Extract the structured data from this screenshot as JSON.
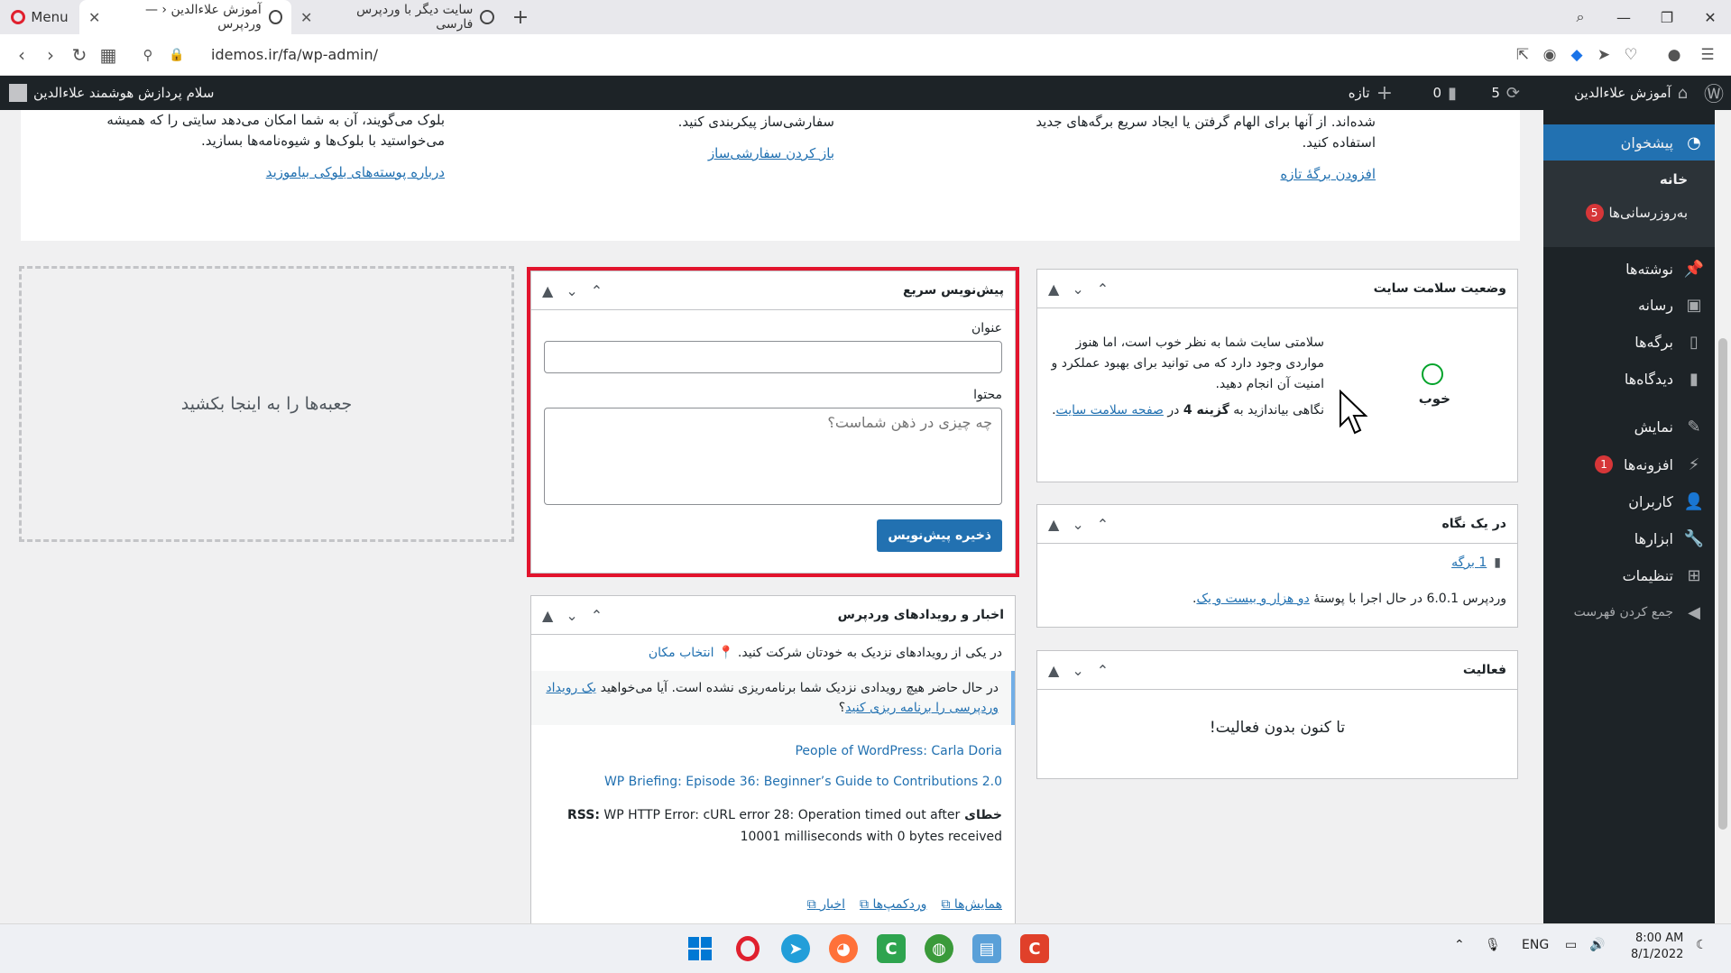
{
  "browser": {
    "menu_label": "Menu",
    "tabs": [
      {
        "title": "آموزش علاءالدین ‹ — وردپرس"
      },
      {
        "title": "سایت دیگر با وردپرس فارسی"
      }
    ],
    "url": "idemos.ir/fa/wp-admin/"
  },
  "adminbar": {
    "site_name": "آموزش علاءالدین",
    "updates_count": "5",
    "comments_count": "0",
    "new_label": "تازه",
    "greeting": "سلام پردازش هوشمند علاءالدین"
  },
  "sidebar": {
    "dashboard": "پیشخوان",
    "home": "خانه",
    "updates": "به‌روزرسانی‌ها",
    "updates_badge": "5",
    "posts": "نوشته‌ها",
    "media": "رسانه",
    "pages": "برگه‌ها",
    "comments": "دیدگاه‌ها",
    "appearance": "نمایش",
    "plugins": "افزونه‌ها",
    "plugins_badge": "1",
    "users": "کاربران",
    "tools": "ابزارها",
    "settings": "تنظیمات",
    "collapse": "جمع کردن فهرست"
  },
  "welcome": {
    "col1_text": "شده‌اند. از آنها برای الهام گرفتن یا ایجاد سریع برگه‌های جدید استفاده کنید.",
    "col1_link": "افزودن برگهٔ تازه",
    "col2_text": "سفارشی‌ساز پیکربندی کنید.",
    "col2_link": "باز کردن سفارشی‌ساز",
    "col3_text": "بلوک می‌گویند، آن به شما امکان می‌دهد سایتی را که همیشه می‌خواستید با بلوک‌ها و شیوه‌نامه‌ها بسازید.",
    "col3_link": "درباره پوسته‌های بلوکی بیاموزید"
  },
  "site_health": {
    "title": "وضعیت سلامت سایت",
    "status": "خوب",
    "text": "سلامتی سایت شما به نظر خوب است، اما هنوز مواردی وجود دارد که می توانید برای بهبود عملکرد و امنیت آن انجام دهید.",
    "text2_prefix": "نگاهی بیاندازید به",
    "text2_bold": "گزینه 4",
    "text2_mid": "در",
    "text2_link": "صفحه سلامت سایت"
  },
  "at_a_glance": {
    "title": "در یک نگاه",
    "pages": "1 برگه",
    "version_text": "وردپرس 6.0.1 در حال اجرا با پوستهٔ",
    "theme_link": "دو هزار و بیست و یک"
  },
  "activity": {
    "title": "فعالیت",
    "empty": "تا کنون بدون فعالیت!"
  },
  "quick_draft": {
    "title": "پیش‌نویس سریع",
    "title_label": "عنوان",
    "title_value": "",
    "content_label": "محتوا",
    "content_placeholder": "چه چیزی در ذهن شماست؟",
    "save_label": "ذخیره پیش‌نویس"
  },
  "events": {
    "title": "اخبار و رویدادهای وردپرس",
    "attend": "در یکی از رویدادهای نزدیک به خودتان شرکت کنید.",
    "select_location": "انتخاب مکان",
    "none_text": "در حال حاضر هیچ رویدادی نزدیک شما برنامه‌ریزی نشده است. آیا می‌خواهید",
    "none_link": "یک رویداد وردپرسی را برنامه ریزی کنید",
    "news1": "People of WordPress: Carla Doria",
    "news2": "WP Briefing: Episode 36: Beginner’s Guide to Contributions 2.0",
    "rss_label": "خطای RSS:",
    "rss_error": "WP HTTP Error: cURL error 28: Operation timed out after 10001 milliseconds with 0 bytes received",
    "footer_meetups": "همایش‌ها",
    "footer_wordcamps": "وردکمپ‌ها",
    "footer_news": "اخبار"
  },
  "dropzone_text": "جعبه‌ها را به اینجا بکشید",
  "taskbar": {
    "lang": "ENG",
    "time": "8:00 AM",
    "date": "8/1/2022"
  },
  "colors": {
    "admin_bg": "#1d2327",
    "accent": "#2271b1",
    "highlight_border": "#e2142d",
    "badge": "#d63638"
  }
}
